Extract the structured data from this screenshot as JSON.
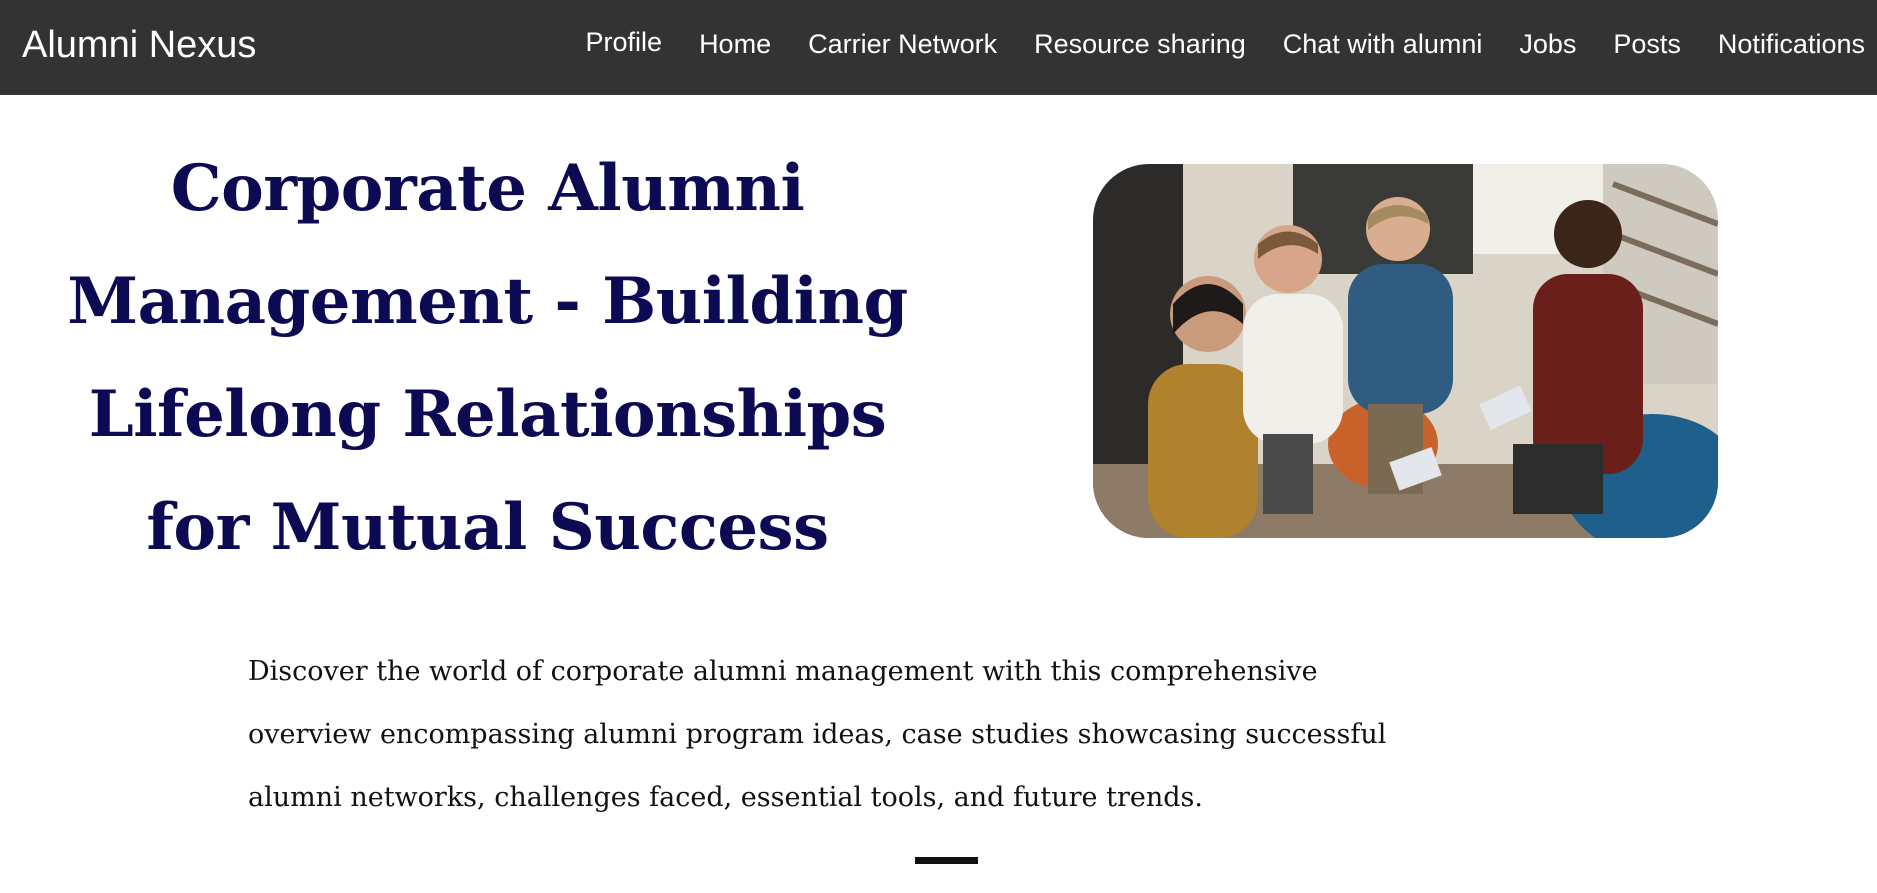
{
  "navbar": {
    "brand": "Alumni Nexus",
    "links": [
      {
        "label": "Profile"
      },
      {
        "label": "Home"
      },
      {
        "label": "Carrier Network"
      },
      {
        "label": "Resource sharing"
      },
      {
        "label": "Chat with alumni"
      },
      {
        "label": "Jobs"
      },
      {
        "label": "Posts"
      },
      {
        "label": "Notifications"
      }
    ]
  },
  "hero": {
    "title": "Corporate Alumni Management - Building Lifelong Relationships for Mutual Success",
    "image_description_icon": "group-meeting-photo"
  },
  "intro": {
    "text": "Discover the world of corporate alumni management with this comprehensive overview encompassing alumni program ideas, case studies showcasing successful alumni networks, challenges faced, essential tools, and future trends."
  },
  "colors": {
    "navbar_bg": "#333333",
    "title_color": "#0b0a52",
    "text_color": "#111111"
  }
}
